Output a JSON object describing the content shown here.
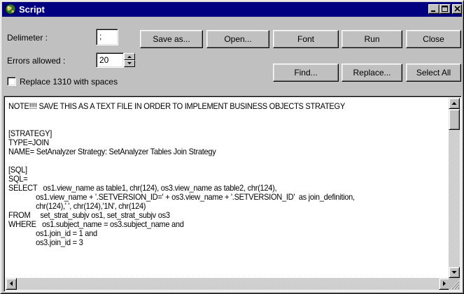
{
  "window": {
    "title": "Script",
    "titlebar_color": "#000080",
    "face_color": "#c0c0c0",
    "icon": "app-globe-icon"
  },
  "controls": {
    "delimiter_label": "Delimeter :",
    "delimiter_value": ";",
    "errors_label": "Errors allowed :",
    "errors_value": "20",
    "replace_label": "Replace 1310 with spaces",
    "replace_checked": false
  },
  "buttons": {
    "save_as": "Save as...",
    "open": "Open...",
    "font": "Font",
    "run": "Run",
    "close": "Close",
    "find": "Find...",
    "replace": "Replace...",
    "select_all": "Select All"
  },
  "script_lines": [
    "NOTE!!!! SAVE THIS AS A TEXT FILE IN ORDER TO IMPLEMENT BUSINESS OBJECTS STRATEGY",
    "",
    "",
    "[STRATEGY]",
    "TYPE=JOIN",
    "NAME= SetAnalyzer Strategy: SetAnalyzer Tables Join Strategy",
    "",
    "[SQL]",
    "SQL=",
    "SELECT   os1.view_name as table1, chr(124), os3.view_name as table2, chr(124),",
    "              os1.view_name + '.SETVERSION_ID=' + os3.view_name + '.SETVERSION_ID'  as join_definition,",
    "              chr(124),' ', chr(124),'1N', chr(124)",
    "FROM     set_strat_subjv os1, set_strat_subjv os3",
    "WHERE   os1.subject_name = os3.subject_name and",
    "              os1.join_id = 1 and",
    "              os3.join_id = 3"
  ]
}
